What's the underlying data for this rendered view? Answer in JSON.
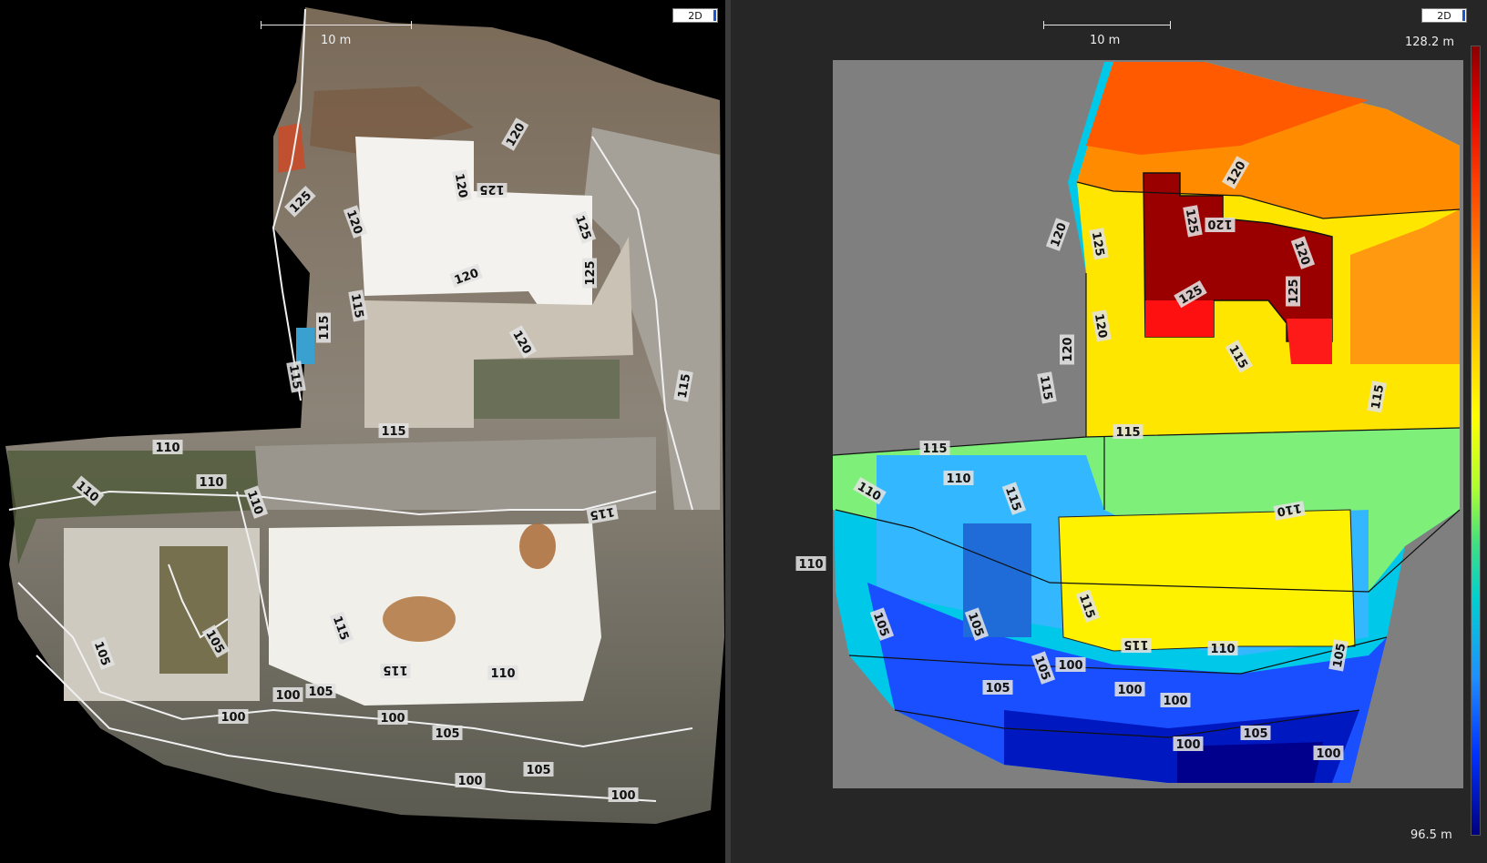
{
  "left_view": {
    "mode_button": "2D",
    "scale_label": "10 m",
    "contour_labels": [
      "120",
      "125",
      "120",
      "125",
      "120",
      "125",
      "125",
      "120",
      "115",
      "120",
      "115",
      "115",
      "115",
      "115",
      "110",
      "110",
      "110",
      "115",
      "110",
      "105",
      "105",
      "115",
      "115",
      "110",
      "100",
      "105",
      "100",
      "100",
      "105",
      "100",
      "105",
      "100"
    ]
  },
  "right_view": {
    "mode_button": "2D",
    "scale_label": "10 m",
    "colorbar": {
      "max_label": "128.2 m",
      "min_label": "96.5 m",
      "max_value": 128.2,
      "min_value": 96.5
    },
    "contour_labels": [
      "120",
      "120",
      "125",
      "120",
      "125",
      "120",
      "125",
      "125",
      "120",
      "115",
      "120",
      "115",
      "115",
      "115",
      "115",
      "110",
      "110",
      "110",
      "115",
      "110",
      "115",
      "105",
      "105",
      "115",
      "110",
      "105",
      "100",
      "105",
      "100",
      "100",
      "105",
      "105",
      "100",
      "100"
    ]
  },
  "colors": {
    "left_background": "#000000",
    "right_background": "#262626",
    "map_canvas": "#7f7f7f"
  }
}
